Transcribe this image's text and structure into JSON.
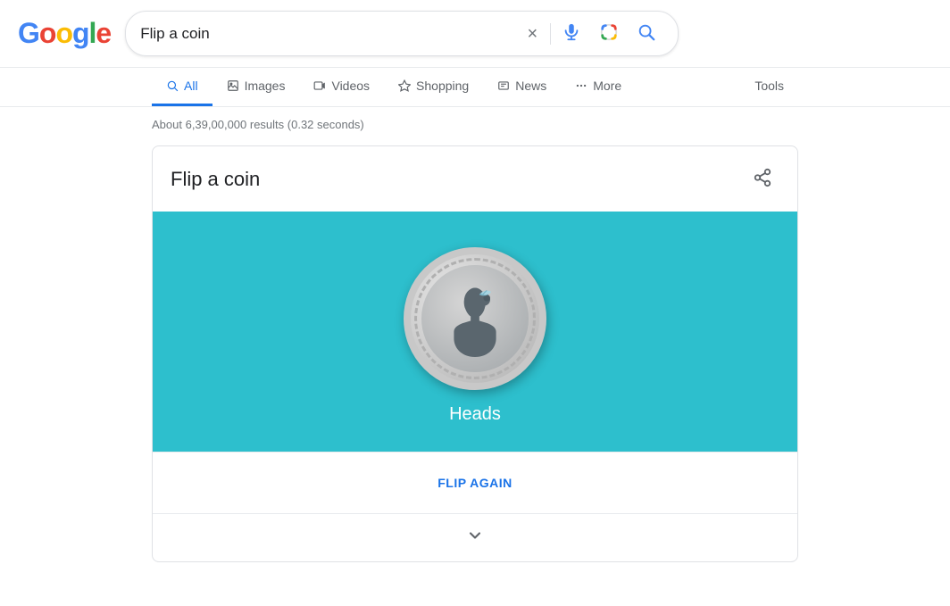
{
  "logo": {
    "letters": [
      {
        "char": "G",
        "color": "#4285F4"
      },
      {
        "char": "o",
        "color": "#EA4335"
      },
      {
        "char": "o",
        "color": "#FBBC05"
      },
      {
        "char": "g",
        "color": "#4285F4"
      },
      {
        "char": "l",
        "color": "#34A853"
      },
      {
        "char": "e",
        "color": "#EA4335"
      }
    ]
  },
  "search": {
    "query": "Flip a coin",
    "clear_label": "×",
    "submit_label": "Search"
  },
  "nav": {
    "tabs": [
      {
        "id": "all",
        "label": "All",
        "icon": "🔍",
        "active": true
      },
      {
        "id": "images",
        "label": "Images",
        "icon": "🖼",
        "active": false
      },
      {
        "id": "videos",
        "label": "Videos",
        "icon": "▶",
        "active": false
      },
      {
        "id": "shopping",
        "label": "Shopping",
        "icon": "◇",
        "active": false
      },
      {
        "id": "news",
        "label": "News",
        "icon": "📰",
        "active": false
      },
      {
        "id": "more",
        "label": "More",
        "icon": "⋮",
        "active": false
      }
    ],
    "tools_label": "Tools"
  },
  "results": {
    "count_text": "About 6,39,00,000 results (0.32 seconds)"
  },
  "coin_card": {
    "title": "Flip a coin",
    "result_label": "Heads",
    "flip_again_label": "FLIP AGAIN",
    "share_label": "Share",
    "bg_color": "#2dbfcd"
  }
}
